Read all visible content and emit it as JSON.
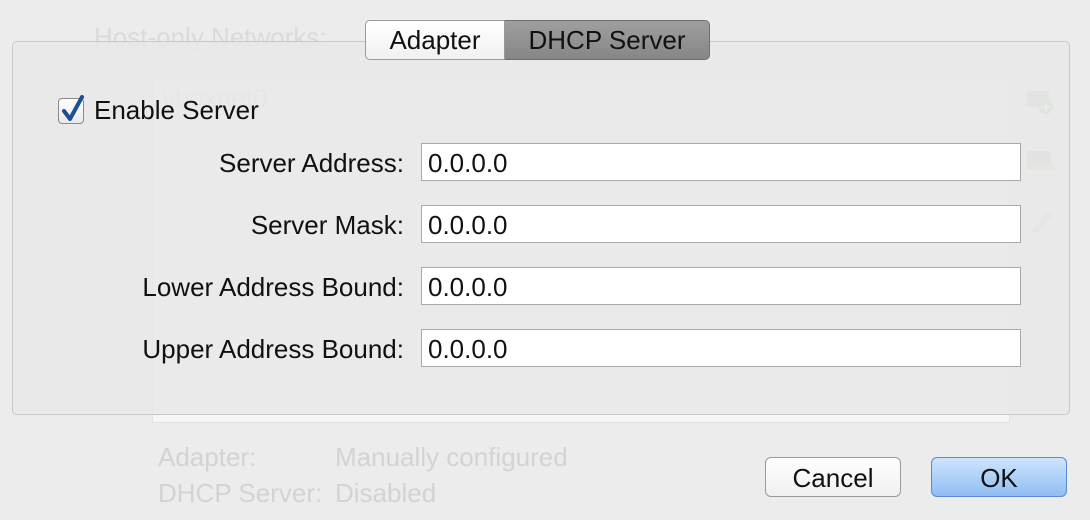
{
  "background": {
    "title": "Host-only Networks:",
    "list_item": "vboxnet0",
    "icons": [
      "add-network-icon",
      "remove-network-icon",
      "edit-network-icon"
    ],
    "status": [
      {
        "key": "Adapter:",
        "value": "Manually configured"
      },
      {
        "key": "DHCP Server:",
        "value": "Disabled"
      }
    ]
  },
  "tabs": [
    {
      "label": "Adapter",
      "selected": false
    },
    {
      "label": "DHCP Server",
      "selected": true
    }
  ],
  "enable_server": {
    "label": "Enable Server",
    "checked": true
  },
  "fields": {
    "server_address": {
      "label": "Server Address:",
      "value": "0.0.0.0"
    },
    "server_mask": {
      "label": "Server Mask:",
      "value": "0.0.0.0"
    },
    "lower_bound": {
      "label": "Lower Address Bound:",
      "value": "0.0.0.0"
    },
    "upper_bound": {
      "label": "Upper Address Bound:",
      "value": "0.0.0.0"
    }
  },
  "buttons": {
    "cancel": "Cancel",
    "ok": "OK"
  },
  "colors": {
    "accent": "#8fbdf4",
    "selected_tab": "#868686",
    "check": "#1e4f96"
  }
}
